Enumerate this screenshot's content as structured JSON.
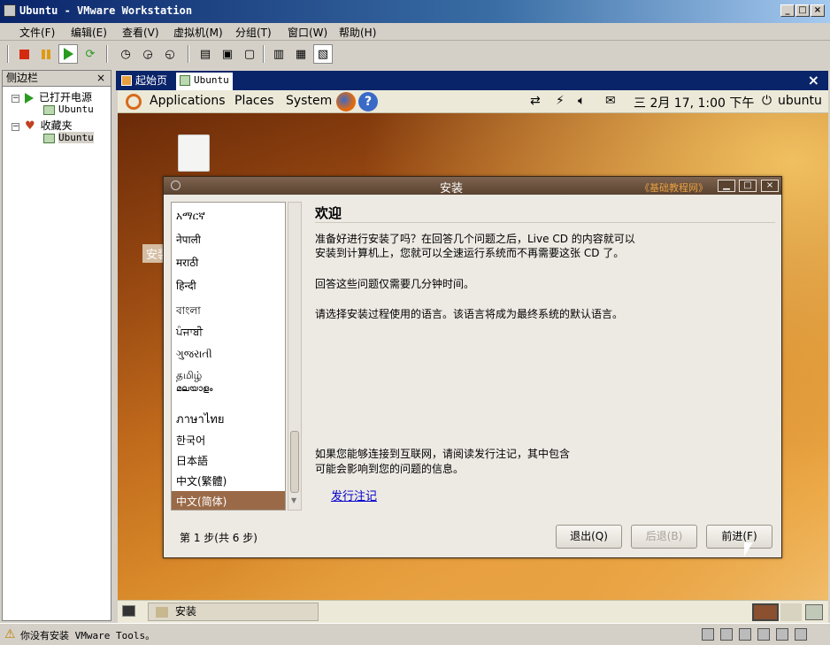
{
  "window": {
    "title": "Ubuntu - VMware Workstation"
  },
  "menu": [
    "文件(F)",
    "编辑(E)",
    "查看(V)",
    "虚拟机(M)",
    "分组(T)",
    "窗口(W)",
    "帮助(H)"
  ],
  "toolbar": {
    "icons": [
      "stop-icon",
      "pause-icon",
      "play-icon",
      "reset-icon",
      "snapshot-icon",
      "revert-icon",
      "manage-snapshots-icon",
      "sidebar-view-icon",
      "fullscreen-icon",
      "quick-switch-icon",
      "summary-icon",
      "console-icon",
      "appliance-icon"
    ]
  },
  "sidebar": {
    "title": "侧边栏",
    "close": "×",
    "powered_on": "已打开电源",
    "vm1": "Ubuntu",
    "favorites": "收藏夹",
    "vm2": "Ubuntu"
  },
  "tabs": {
    "home": "起始页",
    "vm": "Ubuntu",
    "close": "×"
  },
  "gnome": {
    "applications": "Applications",
    "places": "Places",
    "system": "System",
    "datetime": "三 2月 17, 1:00 下午",
    "user": "ubuntu"
  },
  "desktop": {
    "install_label": "安装"
  },
  "dialog": {
    "title": "安装",
    "watermark": "《基础教程网》",
    "heading": "欢迎",
    "p1_line1": "准备好进行安装了吗？在回答几个问题之后，Live CD 的内容就可以",
    "p1_line2": "安装到计算机上，您就可以全速运行系统而不再需要这张 CD 了。",
    "p2": "回答这些问题仅需要几分钟时间。",
    "p3": "请选择安装过程使用的语言。该语言将成为最终系统的默认语言。",
    "p4_line1": "如果您能够连接到互联网，请阅读发行注记，其中包含",
    "p4_line2": "可能会影响到您的问题的信息。",
    "release_notes": "发行注记",
    "step": "第 1 步(共 6 步)",
    "quit": "退出(Q)",
    "back": "后退(B)",
    "forward": "前进(F)",
    "languages": [
      "አማርኛ",
      "नेपाली",
      "मराठी",
      "हिन्दी",
      "বাংলা",
      "ਪੰਜਾਬੀ",
      "ગુજરાતી",
      "தமிழ்",
      "മലയാളം",
      "ภาษาไทย",
      "한국어",
      "日本語",
      "中文(繁體)",
      "中文(简体)"
    ],
    "selected_language": "中文(简体)"
  },
  "taskbar": {
    "install": "安装"
  },
  "status": {
    "message": "你没有安装 VMware Tools。"
  },
  "colors": {
    "accent": "#0a246a",
    "dialog_title": "#5a4230",
    "selection": "#9a6a48",
    "link": "#0000cc"
  }
}
